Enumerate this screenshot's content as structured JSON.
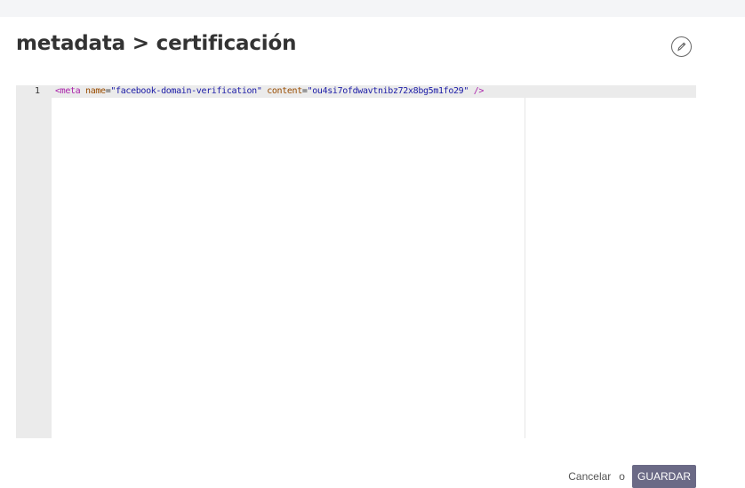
{
  "header": {
    "title": "metadata > certificación",
    "edit_icon": "pencil-icon"
  },
  "editor": {
    "line_number": "1",
    "code": {
      "open": "<meta",
      "attr1": "name",
      "eq1": "=",
      "val1": "\"facebook-domain-verification\"",
      "attr2": "content",
      "eq2": "=",
      "val2": "\"ou4si7ofdwavtnibz72x8bg5m1fo29\"",
      "close": "/>"
    }
  },
  "footer": {
    "cancel_label": "Cancelar",
    "or_label": "o",
    "save_label": "GUARDAR"
  },
  "colors": {
    "save_button_bg": "#6b6a86",
    "gutter_bg": "#ebebeb",
    "tag_color": "#aa22aa",
    "attr_color": "#994c00",
    "string_color": "#1a1aa6"
  }
}
